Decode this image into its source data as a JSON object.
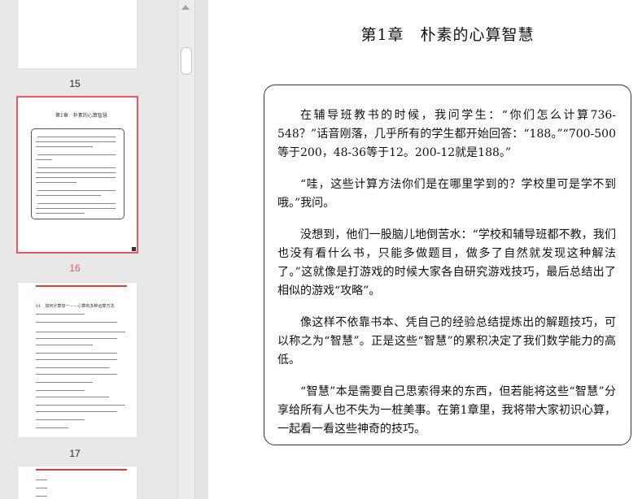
{
  "sidebar": {
    "pages": [
      {
        "label": "15",
        "active": false
      },
      {
        "label": "16",
        "active": true
      },
      {
        "label": "17",
        "active": false
      }
    ],
    "thumb16": {
      "title": "第1章　朴素的心算智慧"
    },
    "thumb17": {
      "heading": "01　如何计算加一——心算有多种运算方法"
    }
  },
  "document": {
    "chapter_title": "第1章　朴素的心算智慧",
    "paragraphs": [
      "在辅导班教书的时候，我问学生：“你们怎么计算736-548？”话音刚落，几乎所有的学生都开始回答：“188。”“700-500等于200，48-36等于12。200-12就是188。”",
      "“哇，这些计算方法你们是在哪里学到的？学校里可是学不到哦。”我问。",
      "没想到，他们一股脑儿地倒苦水：“学校和辅导班都不教，我们也没有看什么书，只能多做题目，做多了自然就发现这种解法了。”这就像是打游戏的时候大家各自研究游戏技巧，最后总结出了相似的游戏“攻略”。",
      "像这样不依靠书本、凭自己的经验总结提炼出的解题技巧，可以称之为“智慧”。正是这些“智慧”的累积决定了我们数学能力的高低。",
      "“智慧”本是需要自己思索得来的东西，但若能将这些“智慧”分享给所有人也不失为一桩美事。在第1章里，我将带大家初识心算，一起看一看这些神奇的技巧。"
    ]
  },
  "colors": {
    "active_label": "#e8505b",
    "selected_outline": "#e35a63"
  }
}
